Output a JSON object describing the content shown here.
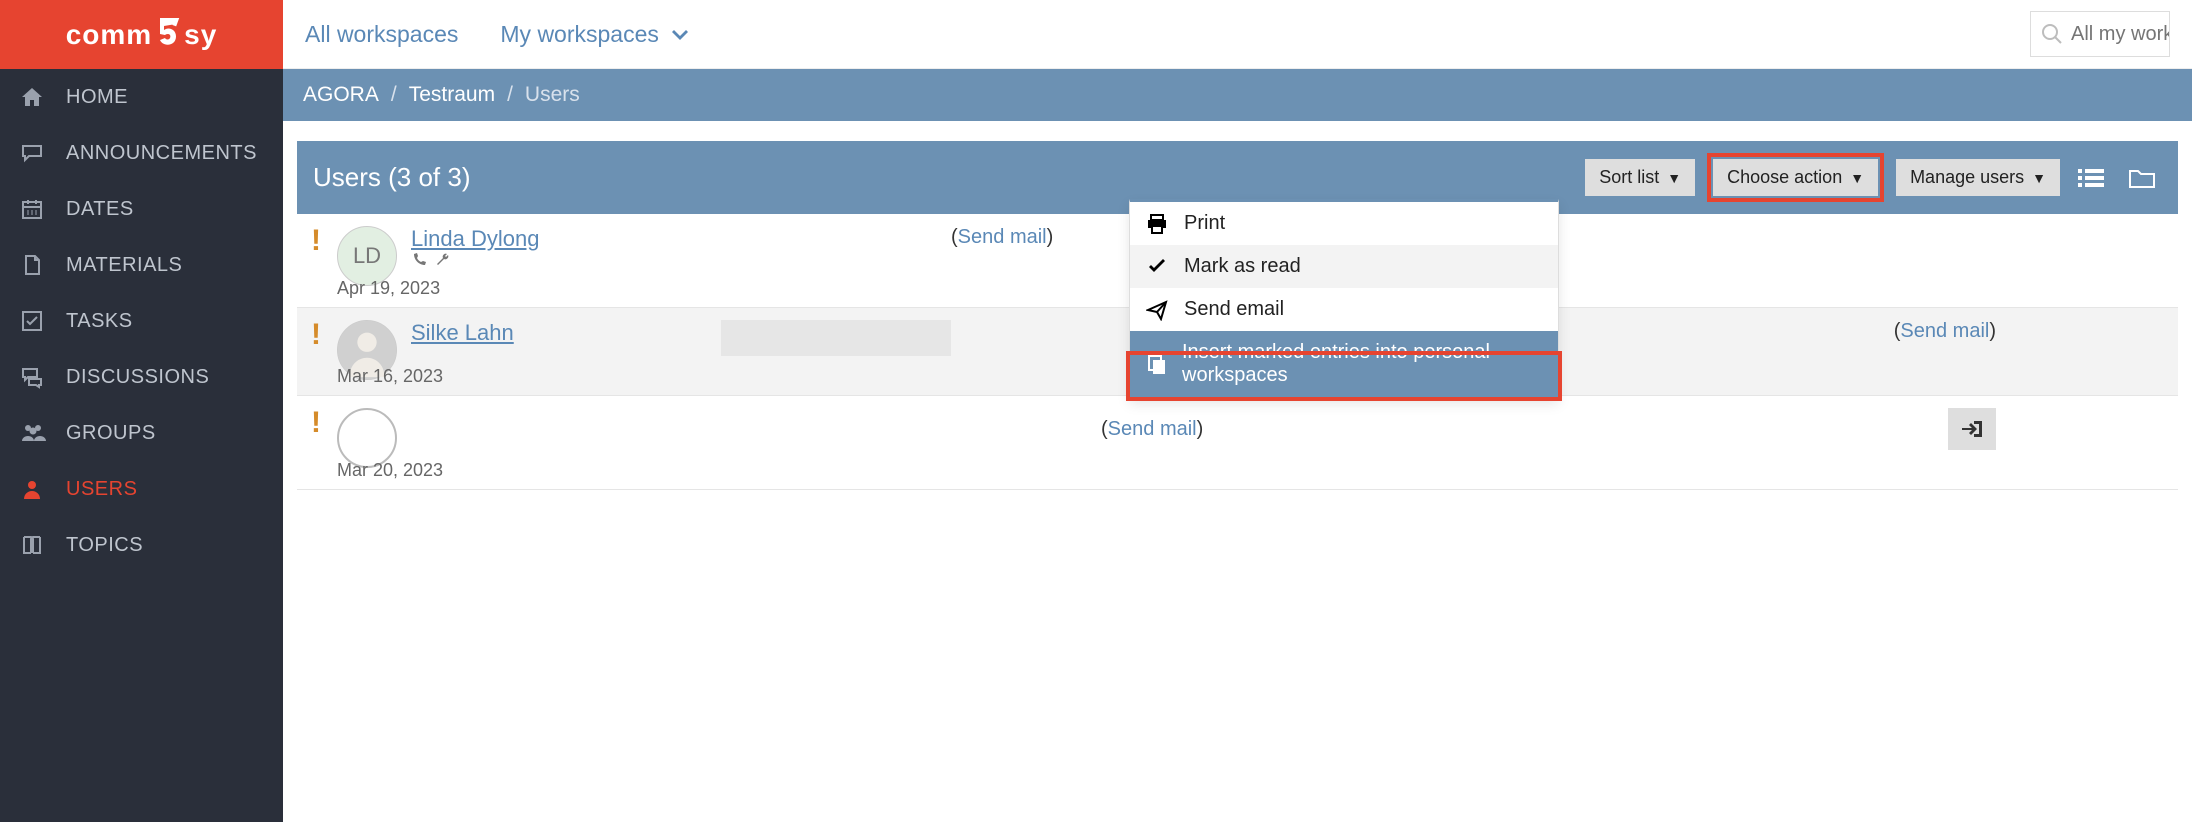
{
  "brand": {
    "name": "commsy"
  },
  "topnav": {
    "all_workspaces": "All workspaces",
    "my_workspaces": "My workspaces"
  },
  "search": {
    "placeholder": "All my works"
  },
  "sidebar": {
    "items": [
      {
        "label": "HOME",
        "icon": "home-icon"
      },
      {
        "label": "ANNOUNCEMENTS",
        "icon": "speech-icon"
      },
      {
        "label": "DATES",
        "icon": "calendar-icon"
      },
      {
        "label": "MATERIALS",
        "icon": "file-icon"
      },
      {
        "label": "TASKS",
        "icon": "check-icon"
      },
      {
        "label": "DISCUSSIONS",
        "icon": "discussion-icon"
      },
      {
        "label": "GROUPS",
        "icon": "groups-icon"
      },
      {
        "label": "USERS",
        "icon": "user-icon"
      },
      {
        "label": "TOPICS",
        "icon": "book-icon"
      }
    ]
  },
  "breadcrumb": {
    "root": "AGORA",
    "room": "Testraum",
    "leaf": "Users"
  },
  "panel": {
    "title": "Users (3 of 3)",
    "sort": "Sort list",
    "choose": "Choose action",
    "manage": "Manage users"
  },
  "dropdown": {
    "print": "Print",
    "mark_read": "Mark as read",
    "send_email": "Send email",
    "insert": "Insert marked entries into personal workspaces"
  },
  "users": [
    {
      "name": "Linda Dylong",
      "initials": "LD",
      "date": "Apr 19, 2023",
      "sendmail": "Send mail"
    },
    {
      "name": "Silke Lahn",
      "initials": "",
      "date": "Mar 16, 2023",
      "sendmail": "Send mail"
    },
    {
      "name": "",
      "initials": "",
      "date": "Mar 20, 2023",
      "sendmail": "Send mail"
    }
  ]
}
